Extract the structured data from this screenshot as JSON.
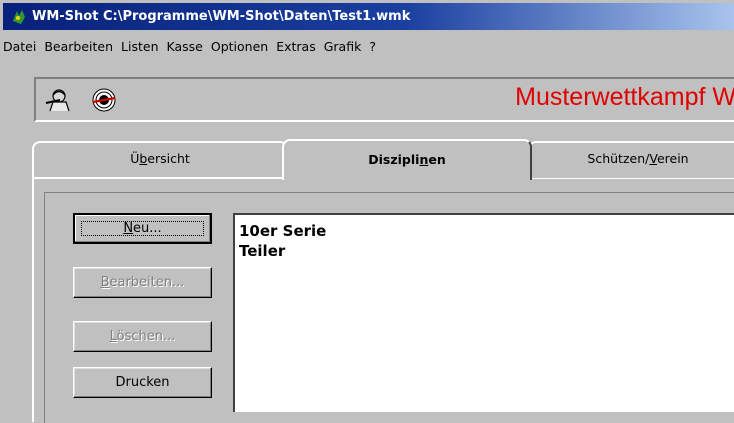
{
  "window": {
    "title": "WM-Shot C:\\Programme\\WM-Shot\\Daten\\Test1.wmk"
  },
  "menu": {
    "items": [
      "Datei",
      "Bearbeiten",
      "Listen",
      "Kasse",
      "Optionen",
      "Extras",
      "Grafik",
      "?"
    ]
  },
  "toolbar": {
    "banner_text": "Musterwettkampf W",
    "banner_color": "#e00000",
    "icons": [
      "shooter-icon",
      "target-icon"
    ]
  },
  "tabs": [
    {
      "label_pre": "Ü",
      "label_u": "b",
      "label_post": "ersicht",
      "selected": false
    },
    {
      "label_pre": "Diszipli",
      "label_u": "n",
      "label_post": "en",
      "selected": true
    },
    {
      "label_pre": "Schützen/",
      "label_u": "V",
      "label_post": "erein",
      "selected": false
    }
  ],
  "buttons": {
    "new": {
      "pre": "",
      "u": "N",
      "post": "eu..."
    },
    "edit": {
      "pre": "",
      "u": "B",
      "post": "earbeiten..."
    },
    "delete": {
      "pre": "",
      "u": "L",
      "post": "öschen..."
    },
    "print": {
      "pre": "",
      "u": "",
      "post": "Drucken"
    }
  },
  "disciplines": [
    "10er Serie",
    "Teiler"
  ],
  "colors": {
    "title_bar": "#08217b",
    "face": "#c0c0c0"
  }
}
